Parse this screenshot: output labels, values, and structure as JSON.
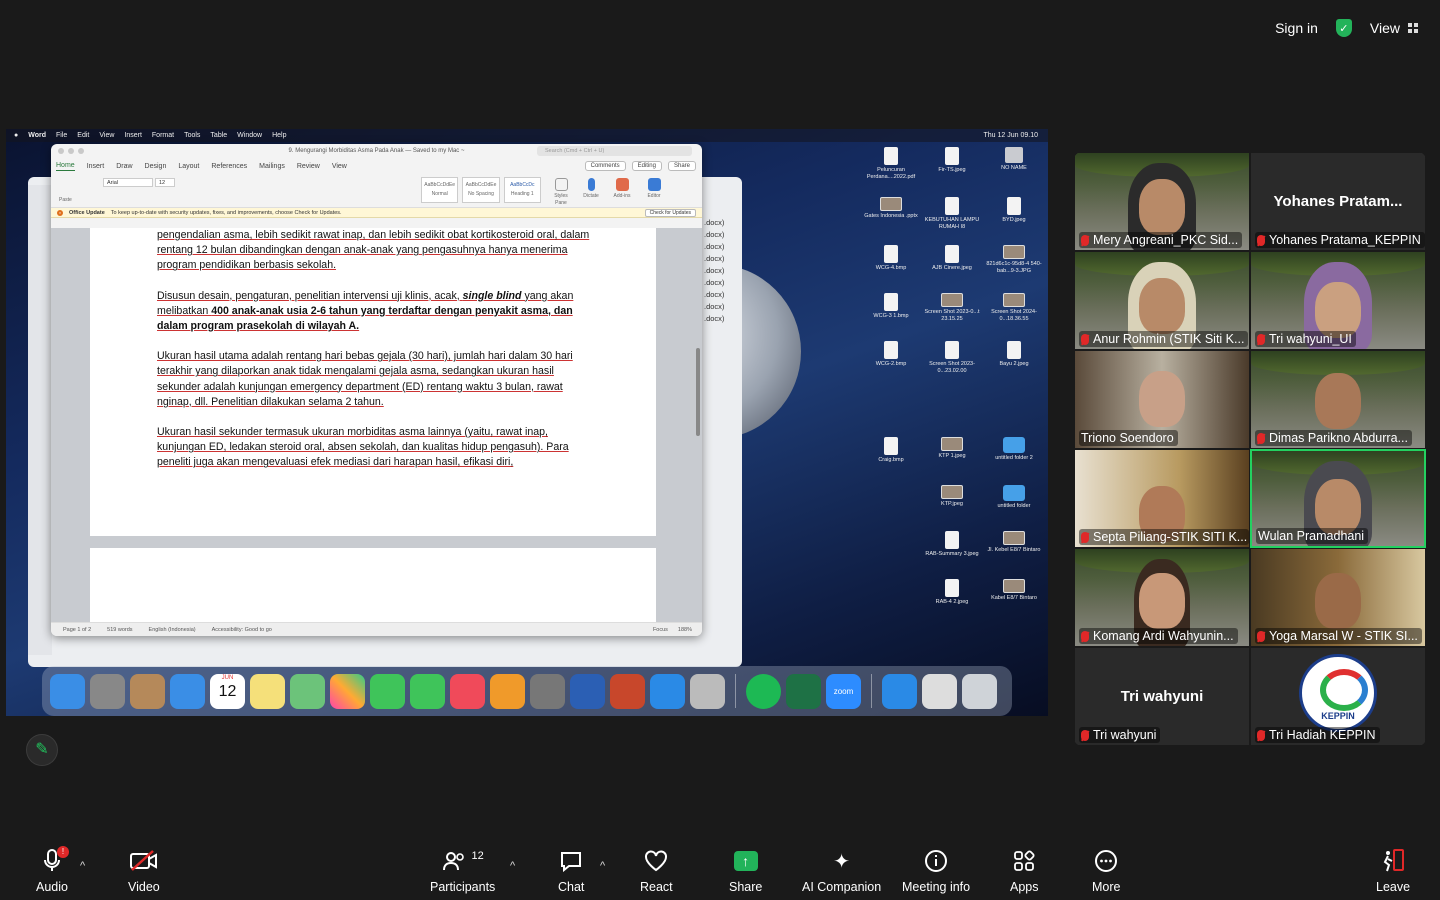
{
  "topbar": {
    "sign_in": "Sign in",
    "view": "View"
  },
  "mac": {
    "menu": [
      "Word",
      "File",
      "Edit",
      "View",
      "Insert",
      "Format",
      "Tools",
      "Table",
      "Window",
      "Help"
    ],
    "clock": "Thu 12 Jun 09.10"
  },
  "word": {
    "title": "9. Mengurangi Morbiditas Asma Pada Anak — Saved to my Mac ~",
    "search_placeholder": "Search (Cmd + Ctrl + U)",
    "tabs": [
      "Home",
      "Insert",
      "Draw",
      "Design",
      "Layout",
      "References",
      "Mailings",
      "Review",
      "View"
    ],
    "comments": "Comments",
    "editing": "Editing",
    "share": "Share",
    "font": "Arial",
    "size": "12",
    "ribbon_labels": [
      "Paste",
      "Styles Pane",
      "Dictate",
      "Add-ins",
      "Editor"
    ],
    "styles": [
      {
        "sample": "AaBbCcDdEe",
        "label": "Normal"
      },
      {
        "sample": "AaBbCcDdEe",
        "label": "No Spacing"
      },
      {
        "sample": "AaBbCcDc",
        "label": "Heading 1"
      }
    ],
    "update_title": "Office Update",
    "update_text": "To keep up-to-date with security updates, fixes, and improvements, choose Check for Updates.",
    "update_button": "Check for Updates",
    "para1": "pengendalian asma, lebih sedikit rawat inap, dan lebih sedikit obat kortikosteroid oral, dalam rentang 12 bulan dibandingkan dengan anak-anak yang pengasuhnya hanya menerima program pendidikan berbasis sekolah.",
    "para2a": "Disusun desain, pengaturan, penelitian intervensi uji klinis, acak, ",
    "para2b": "single blind",
    "para2c": " yang akan melibatkan ",
    "para2d": "400 anak-anak usia 2-6 tahun yang terdaftar dengan penyakit asma, dan dalam program prasekolah di wilayah A.",
    "para3": "Ukuran hasil utama adalah rentang hari bebas gejala (30 hari), jumlah hari dalam 30 hari terakhir yang dilaporkan anak tidak mengalami gejala asma, sedangkan ukuran hasil sekunder adalah kunjungan emergency department (ED) rentang waktu 3 bulan, rawat nginap, dll. Penelitian dilakukan selama 2 tahun.",
    "para4": "Ukuran hasil sekunder termasuk ukuran morbiditas asma lainnya (yaitu, rawat inap, kunjungan ED, ledakan steroid oral, absen sekolah, dan kualitas hidup pengasuh). Para peneliti juga akan mengevaluasi efek mediasi dari harapan hasil, efikasi diri,",
    "status": {
      "page": "Page 1 of 2",
      "words": "519 words",
      "language": "English (Indonesia)",
      "accessibility": "Accessibility: Good to go",
      "focus": "Focus",
      "zoom": "188%"
    }
  },
  "backlist": [
    ".docx)",
    ".docx)",
    ".docx)",
    ".docx)",
    ".docx)",
    ".docx)",
    ".docx)",
    ".docx)",
    ".docx)"
  ],
  "desktop": [
    {
      "label": "Peluncuran Perdana....2022.pdf"
    },
    {
      "label": "Fir-TS.jpeg"
    },
    {
      "label": "NO NAME"
    },
    {
      "label": "Gates Indonesia .pptx"
    },
    {
      "label": "KEBUTUHAN LAMPU RUMAH I8"
    },
    {
      "label": "BYD.jpeg"
    },
    {
      "label": "WCG-4.bmp"
    },
    {
      "label": "AJB Cinere.jpeg"
    },
    {
      "label": "821d6c1c-95d8-4 540-bab...9-3.JPG"
    },
    {
      "label": "WCG-3 1.bmp"
    },
    {
      "label": "Screen Shot 2023-0...t 23.15.25"
    },
    {
      "label": "Screen Shot 2024-0...18.36.55"
    },
    {
      "label": "WCG-2.bmp"
    },
    {
      "label": "Screen Shot 2023-0...23.02.00"
    },
    {
      "label": "Bayu 2.jpeg"
    },
    {
      "label": "Craig.bmp"
    },
    {
      "label": "KTP 1.jpeg"
    },
    {
      "label": "untitled folder 2"
    },
    {
      "label": "KTP.jpeg"
    },
    {
      "label": "untitled folder"
    },
    {
      "label": "RAB-Summary 3.jpeg"
    },
    {
      "label": "Jl. Kebel E8/7 Bintaro"
    },
    {
      "label": "RAB-4 2.jpeg"
    },
    {
      "label": "Kabel E8/7 Bintaro"
    }
  ],
  "dock": {
    "calendar_month": "JUN",
    "calendar_day": "12",
    "zoom": "zoom"
  },
  "participants": [
    {
      "name": "Mery Angreani_PKC Sid...",
      "video": true
    },
    {
      "name": "Yohanes Pratama_KEPPIN",
      "center": "Yohanes  Pratam...",
      "video": false
    },
    {
      "name": "Anur Rohmin (STIK Siti K...",
      "video": true
    },
    {
      "name": "Tri wahyuni_UI",
      "video": true
    },
    {
      "name": "Triono Soendoro",
      "video": true
    },
    {
      "name": "Dimas Parikno Abdurra...",
      "video": true
    },
    {
      "name": "Septa Piliang-STIK SITI K...",
      "video": true
    },
    {
      "name": "Wulan Pramadhani",
      "video": true,
      "active": true
    },
    {
      "name": "Komang Ardi Wahyunin...",
      "video": true
    },
    {
      "name": "Yoga Marsal W - STIK SI...",
      "video": true
    },
    {
      "name": "Tri wahyuni",
      "center": "Tri wahyuni",
      "video": false
    },
    {
      "name": "Tri Hadiah KEPPIN",
      "logo": "KEPPIN",
      "video": false
    }
  ],
  "toolbar": {
    "audio": "Audio",
    "video": "Video",
    "participants": "Participants",
    "participants_count": "12",
    "chat": "Chat",
    "react": "React",
    "share": "Share",
    "ai": "AI Companion",
    "info": "Meeting info",
    "apps": "Apps",
    "more": "More",
    "leave": "Leave",
    "audio_badge": "!"
  },
  "colors": {
    "accent_green": "#22b35a",
    "mute_red": "#e02828",
    "active_border": "#23d160"
  }
}
